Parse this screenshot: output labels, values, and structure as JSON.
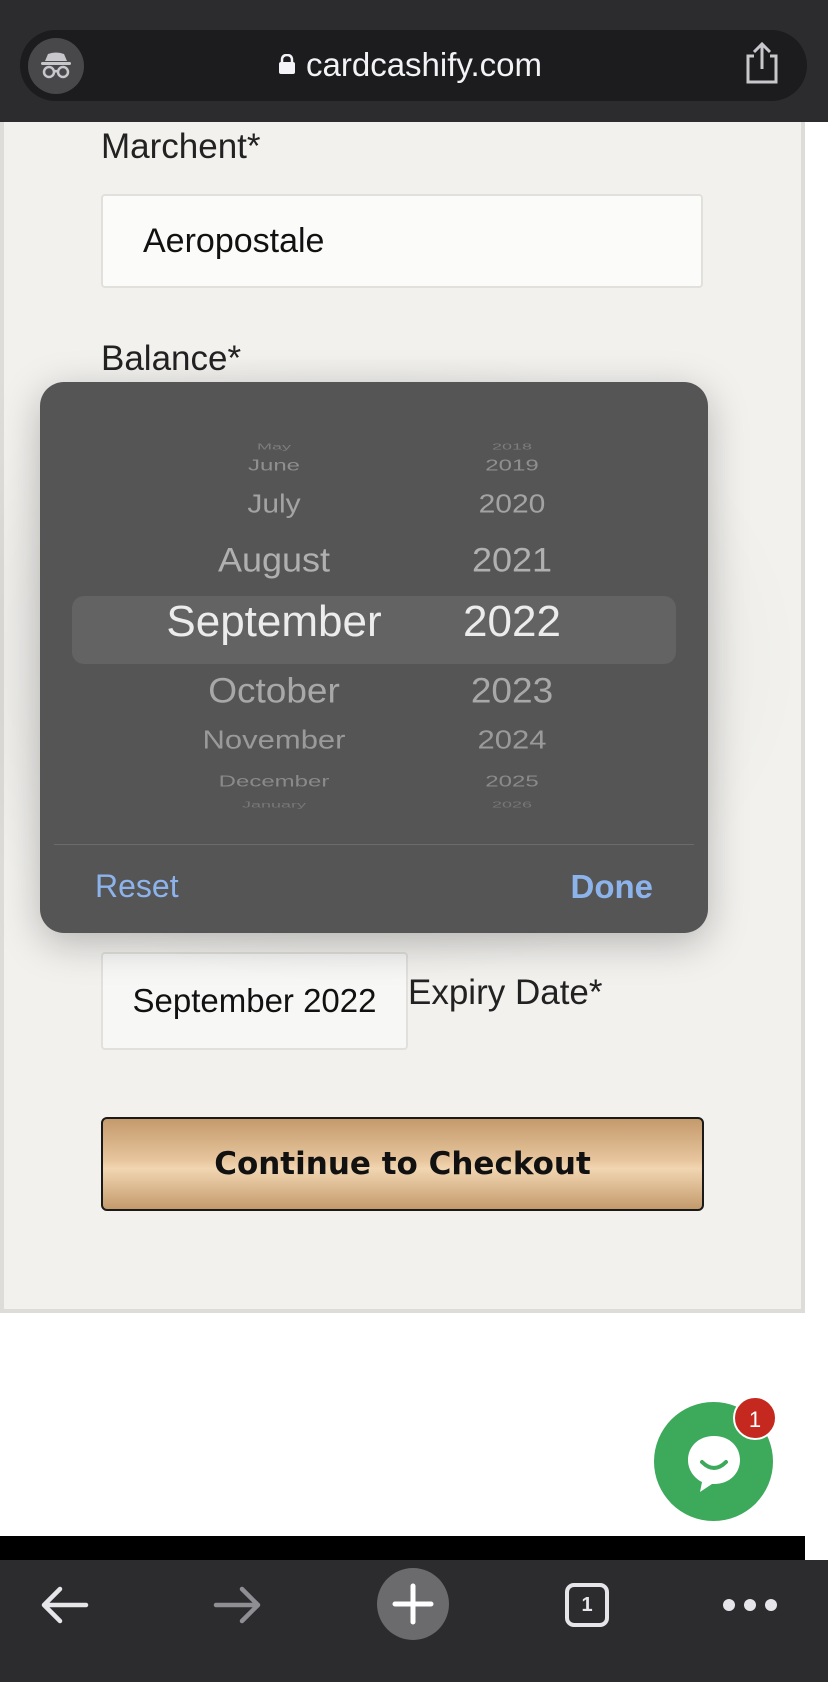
{
  "browser": {
    "url": "cardcashify.com",
    "tab_count": "1"
  },
  "form": {
    "merchant_label": "Marchent*",
    "merchant_value": "Aeropostale",
    "balance_label": "Balance*",
    "expiry_value": "September 2022",
    "expiry_label": "Expiry Date*",
    "checkout_label": "Continue to Checkout"
  },
  "picker": {
    "months": [
      "May",
      "June",
      "July",
      "August",
      "September",
      "October",
      "November",
      "December",
      "January"
    ],
    "years": [
      "2018",
      "2019",
      "2020",
      "2021",
      "2022",
      "2023",
      "2024",
      "2025",
      "2026"
    ],
    "selected_month": "September",
    "selected_year": "2022",
    "reset_label": "Reset",
    "done_label": "Done"
  },
  "chat": {
    "badge_count": "1"
  },
  "colors": {
    "accent_link": "#8db3ec",
    "chat_green": "#3ca95b",
    "badge_red": "#c4281f",
    "checkout_gold": "#e6c49c"
  }
}
